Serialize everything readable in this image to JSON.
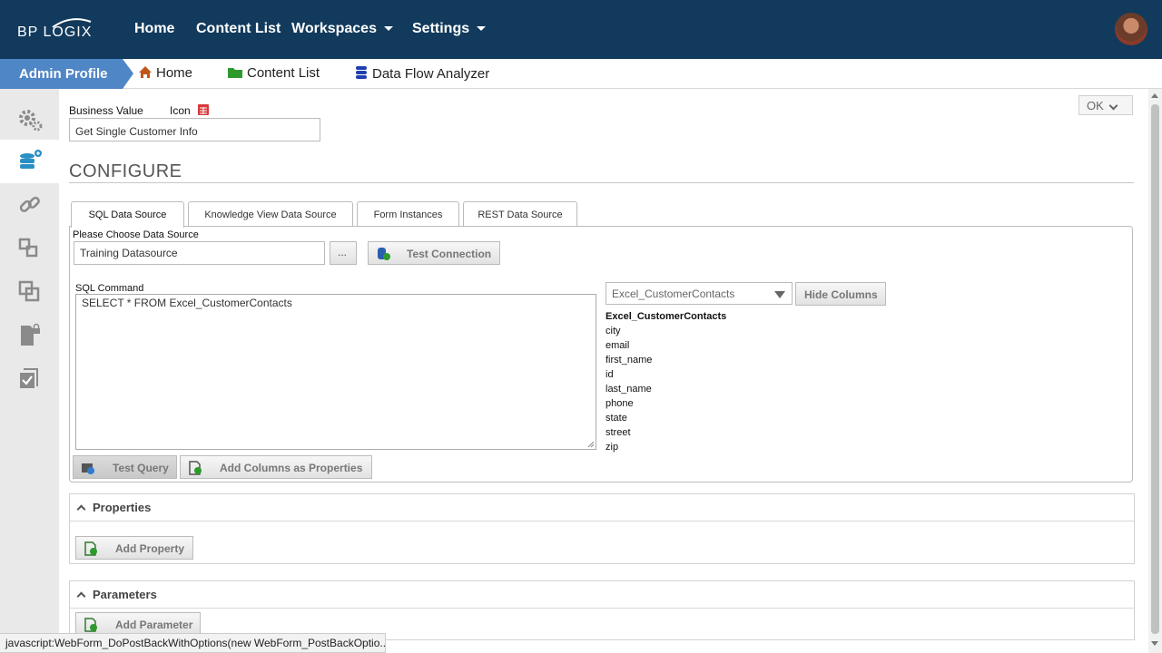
{
  "topnav": {
    "logo": "BP LOGIX",
    "links": [
      "Home",
      "Content List",
      "Workspaces",
      "Settings"
    ]
  },
  "breadcrumb": {
    "admin_profile": "Admin Profile",
    "home": "Home",
    "content_list": "Content List",
    "data_flow_analyzer": "Data Flow Analyzer"
  },
  "rail": {
    "icons": [
      "gears-icon",
      "database-add-icon",
      "link-icon",
      "move-icon",
      "copy-icon",
      "lock-document-icon",
      "checklist-icon"
    ]
  },
  "form": {
    "business_value_label": "Business Value",
    "icon_label": "Icon",
    "business_value": "Get Single Customer Info",
    "ok_label": "OK",
    "section_title": "CONFIGURE"
  },
  "tabs": [
    "SQL Data Source",
    "Knowledge View Data Source",
    "Form Instances",
    "REST Data Source"
  ],
  "sql_source": {
    "choose_label": "Please Choose Data Source",
    "data_source": "Training Datasource",
    "browse_label": "...",
    "test_connection": "Test Connection",
    "sql_command_label": "SQL Command",
    "sql_command": "SELECT * FROM Excel_CustomerContacts",
    "table_select": "Excel_CustomerContacts",
    "hide_columns": "Hide Columns",
    "columns_header": "Excel_CustomerContacts",
    "columns": [
      "city",
      "email",
      "first_name",
      "id",
      "last_name",
      "phone",
      "state",
      "street",
      "zip"
    ],
    "test_query": "Test Query",
    "add_columns": "Add Columns as Properties"
  },
  "properties": {
    "title": "Properties",
    "add_label": "Add Property"
  },
  "parameters": {
    "title": "Parameters",
    "add_label": "Add Parameter"
  },
  "status": {
    "text": "javascript:WebForm_DoPostBackWithOptions(new WebForm_PostBackOptio..."
  },
  "colors": {
    "nav_bg": "#123a5c",
    "admin_tab": "#4f86c6",
    "rail_bg": "#e9e9e9"
  }
}
